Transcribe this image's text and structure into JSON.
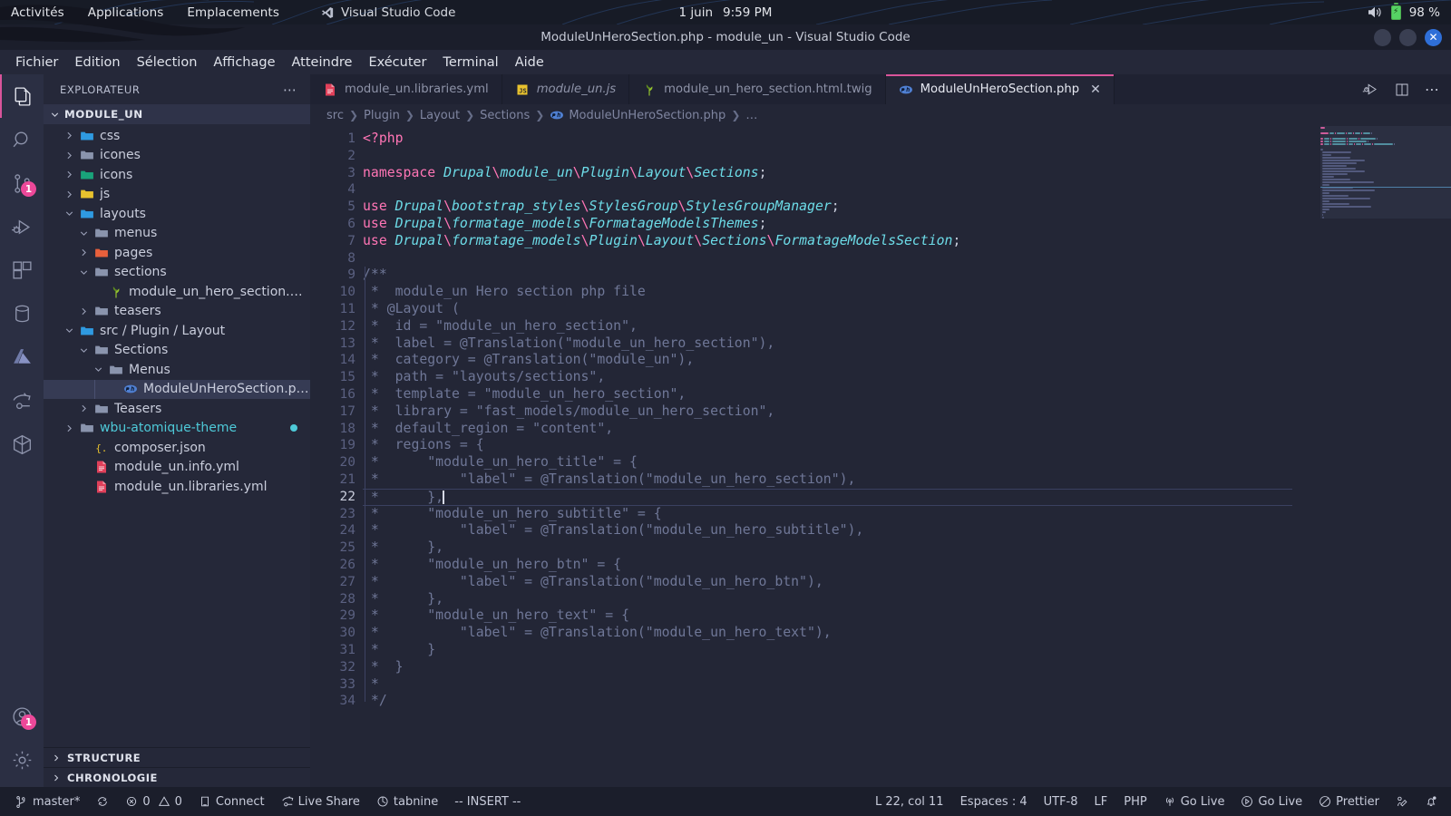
{
  "gnome": {
    "activities": "Activités",
    "applications": "Applications",
    "places": "Emplacements",
    "app_name": "Visual Studio Code",
    "app_icon": "vscode-icon",
    "date": "1 juin",
    "time": "9:59 PM",
    "volume_icon": "speaker-icon",
    "battery_icon": "battery-charging-icon",
    "battery": "98 %"
  },
  "window": {
    "title": "ModuleUnHeroSection.php - module_un - Visual Studio Code",
    "minimize_icon": "minimize-icon",
    "maximize_icon": "maximize-icon",
    "close_icon": "close-icon"
  },
  "menubar": {
    "items": [
      {
        "label": "Fichier"
      },
      {
        "label": "Edition"
      },
      {
        "label": "Sélection"
      },
      {
        "label": "Affichage"
      },
      {
        "label": "Atteindre"
      },
      {
        "label": "Exécuter"
      },
      {
        "label": "Terminal"
      },
      {
        "label": "Aide"
      }
    ]
  },
  "activitybar": {
    "items": [
      {
        "name": "explorer-icon",
        "badge": ""
      },
      {
        "name": "search-icon",
        "badge": ""
      },
      {
        "name": "source-control-icon",
        "badge": "1"
      },
      {
        "name": "run-debug-icon",
        "badge": ""
      },
      {
        "name": "extensions-icon",
        "badge": ""
      },
      {
        "name": "database-icon",
        "badge": ""
      },
      {
        "name": "azure-icon",
        "badge": ""
      },
      {
        "name": "live-share-icon",
        "badge": ""
      },
      {
        "name": "docker-icon",
        "badge": ""
      }
    ],
    "bottom": [
      {
        "name": "account-icon",
        "badge": "1"
      },
      {
        "name": "settings-gear-icon",
        "badge": ""
      }
    ]
  },
  "sidebar": {
    "title": "EXPLORATEUR",
    "more_icon": "more-actions-icon",
    "root": "MODULE_UN",
    "tree": [
      {
        "label": "css",
        "indent": 1,
        "type": "folder",
        "state": "collapsed",
        "color": "#2f9ae0"
      },
      {
        "label": "icones",
        "indent": 1,
        "type": "folder",
        "state": "collapsed",
        "color": "#8a94ad"
      },
      {
        "label": "icons",
        "indent": 1,
        "type": "folder",
        "state": "collapsed",
        "color": "#1aa37a"
      },
      {
        "label": "js",
        "indent": 1,
        "type": "folder",
        "state": "collapsed",
        "color": "#e8c22e"
      },
      {
        "label": "layouts",
        "indent": 1,
        "type": "folder",
        "state": "expanded",
        "color": "#2f9ae0"
      },
      {
        "label": "menus",
        "indent": 2,
        "type": "folder",
        "state": "expanded",
        "color": "#8a94ad"
      },
      {
        "label": "pages",
        "indent": 2,
        "type": "folder",
        "state": "collapsed",
        "color": "#e8603c"
      },
      {
        "label": "sections",
        "indent": 2,
        "type": "folder",
        "state": "expanded",
        "color": "#8a94ad"
      },
      {
        "label": "module_un_hero_section.html.twig",
        "indent": 3,
        "type": "twig",
        "state": "none",
        "color": "#93c22e"
      },
      {
        "label": "teasers",
        "indent": 2,
        "type": "folder",
        "state": "collapsed",
        "color": "#8a94ad"
      },
      {
        "label": "src / Plugin / Layout",
        "indent": 1,
        "type": "folder",
        "state": "expanded",
        "color": "#2f9ae0"
      },
      {
        "label": "Sections",
        "indent": 2,
        "type": "folder",
        "state": "expanded",
        "color": "#8a94ad"
      },
      {
        "label": "Menus",
        "indent": 3,
        "type": "folder",
        "state": "expanded",
        "color": "#8a94ad"
      },
      {
        "label": "ModuleUnHeroSection.php",
        "indent": 4,
        "type": "php",
        "state": "none",
        "color": "#4f7fd1",
        "selected": true
      },
      {
        "label": "Teasers",
        "indent": 2,
        "type": "folder",
        "state": "collapsed",
        "color": "#8a94ad"
      },
      {
        "label": "wbu-atomique-theme",
        "indent": 1,
        "type": "folder",
        "state": "collapsed",
        "color": "#8a94ad",
        "modified": true,
        "dot": true
      },
      {
        "label": "composer.json",
        "indent": 2,
        "type": "json",
        "state": "none",
        "color": "#e8c22e"
      },
      {
        "label": "module_un.info.yml",
        "indent": 2,
        "type": "yml",
        "state": "none",
        "color": "#e0405a"
      },
      {
        "label": "module_un.libraries.yml",
        "indent": 2,
        "type": "yml",
        "state": "none",
        "color": "#e0405a"
      }
    ],
    "panels": [
      {
        "label": "STRUCTURE"
      },
      {
        "label": "CHRONOLOGIE"
      }
    ]
  },
  "editor": {
    "tabs": [
      {
        "label": "module_un.libraries.yml",
        "icon": "yml-file-icon",
        "active": false,
        "italic": false,
        "iconColor": "#e0405a"
      },
      {
        "label": "module_un.js",
        "icon": "js-file-icon",
        "active": false,
        "italic": true,
        "iconColor": "#e8c22e"
      },
      {
        "label": "module_un_hero_section.html.twig",
        "icon": "twig-file-icon",
        "active": false,
        "italic": false,
        "iconColor": "#93c22e"
      },
      {
        "label": "ModuleUnHeroSection.php",
        "icon": "php-file-icon",
        "active": true,
        "italic": false,
        "iconColor": "#4f7fd1"
      }
    ],
    "tab_close_icon": "close-icon",
    "actions": [
      {
        "name": "run-and-debug-icon"
      },
      {
        "name": "split-editor-icon"
      },
      {
        "name": "more-actions-icon"
      }
    ],
    "breadcrumbs": [
      {
        "label": "src"
      },
      {
        "label": "Plugin"
      },
      {
        "label": "Layout"
      },
      {
        "label": "Sections"
      },
      {
        "label": "ModuleUnHeroSection.php",
        "icon": "php-file-icon"
      },
      {
        "label": "…"
      }
    ],
    "first_line": 1,
    "total_lines": 34,
    "cursor_line": 22,
    "lines": [
      {
        "n": 1,
        "tokens": [
          {
            "t": "<?php",
            "c": "tagphp"
          }
        ]
      },
      {
        "n": 2,
        "tokens": []
      },
      {
        "n": 3,
        "tokens": [
          {
            "t": "namespace ",
            "c": "kw"
          },
          {
            "t": "Drupal",
            "c": "cls"
          },
          {
            "t": "\\",
            "c": "sep"
          },
          {
            "t": "module_un",
            "c": "cls"
          },
          {
            "t": "\\",
            "c": "sep"
          },
          {
            "t": "Plugin",
            "c": "cls"
          },
          {
            "t": "\\",
            "c": "sep"
          },
          {
            "t": "Layout",
            "c": "cls"
          },
          {
            "t": "\\",
            "c": "sep"
          },
          {
            "t": "Sections",
            "c": "cls"
          },
          {
            "t": ";",
            "c": "punc"
          }
        ]
      },
      {
        "n": 4,
        "tokens": []
      },
      {
        "n": 5,
        "tokens": [
          {
            "t": "use ",
            "c": "kw"
          },
          {
            "t": "Drupal",
            "c": "cls"
          },
          {
            "t": "\\",
            "c": "sep"
          },
          {
            "t": "bootstrap_styles",
            "c": "cls"
          },
          {
            "t": "\\",
            "c": "sep"
          },
          {
            "t": "StylesGroup",
            "c": "cls"
          },
          {
            "t": "\\",
            "c": "sep"
          },
          {
            "t": "StylesGroupManager",
            "c": "cls"
          },
          {
            "t": ";",
            "c": "punc"
          }
        ]
      },
      {
        "n": 6,
        "tokens": [
          {
            "t": "use ",
            "c": "kw"
          },
          {
            "t": "Drupal",
            "c": "cls"
          },
          {
            "t": "\\",
            "c": "sep"
          },
          {
            "t": "formatage_models",
            "c": "cls"
          },
          {
            "t": "\\",
            "c": "sep"
          },
          {
            "t": "FormatageModelsThemes",
            "c": "cls"
          },
          {
            "t": ";",
            "c": "punc"
          }
        ]
      },
      {
        "n": 7,
        "tokens": [
          {
            "t": "use ",
            "c": "kw"
          },
          {
            "t": "Drupal",
            "c": "cls"
          },
          {
            "t": "\\",
            "c": "sep"
          },
          {
            "t": "formatage_models",
            "c": "cls"
          },
          {
            "t": "\\",
            "c": "sep"
          },
          {
            "t": "Plugin",
            "c": "cls"
          },
          {
            "t": "\\",
            "c": "sep"
          },
          {
            "t": "Layout",
            "c": "cls"
          },
          {
            "t": "\\",
            "c": "sep"
          },
          {
            "t": "Sections",
            "c": "cls"
          },
          {
            "t": "\\",
            "c": "sep"
          },
          {
            "t": "FormatageModelsSection",
            "c": "cls"
          },
          {
            "t": ";",
            "c": "punc"
          }
        ]
      },
      {
        "n": 8,
        "tokens": []
      },
      {
        "n": 9,
        "tokens": [
          {
            "t": "/**",
            "c": "cm"
          }
        ]
      },
      {
        "n": 10,
        "tokens": [
          {
            "t": " *  module_un Hero section php file",
            "c": "cm"
          }
        ]
      },
      {
        "n": 11,
        "tokens": [
          {
            "t": " * @Layout (",
            "c": "cm"
          }
        ]
      },
      {
        "n": 12,
        "tokens": [
          {
            "t": " *  id = \"module_un_hero_section\",",
            "c": "cm"
          }
        ]
      },
      {
        "n": 13,
        "tokens": [
          {
            "t": " *  label = @Translation(\"module_un_hero_section\"),",
            "c": "cm"
          }
        ]
      },
      {
        "n": 14,
        "tokens": [
          {
            "t": " *  category = @Translation(\"module_un\"),",
            "c": "cm"
          }
        ]
      },
      {
        "n": 15,
        "tokens": [
          {
            "t": " *  path = \"layouts/sections\",",
            "c": "cm"
          }
        ]
      },
      {
        "n": 16,
        "tokens": [
          {
            "t": " *  template = \"module_un_hero_section\",",
            "c": "cm"
          }
        ]
      },
      {
        "n": 17,
        "tokens": [
          {
            "t": " *  library = \"fast_models/module_un_hero_section\",",
            "c": "cm"
          }
        ]
      },
      {
        "n": 18,
        "tokens": [
          {
            "t": " *  default_region = \"content\",",
            "c": "cm"
          }
        ]
      },
      {
        "n": 19,
        "tokens": [
          {
            "t": " *  regions = {",
            "c": "cm"
          }
        ]
      },
      {
        "n": 20,
        "tokens": [
          {
            "t": " *      \"module_un_hero_title\" = {",
            "c": "cm"
          }
        ]
      },
      {
        "n": 21,
        "tokens": [
          {
            "t": " *          \"label\" = @Translation(\"module_un_hero_section\"),",
            "c": "cm"
          }
        ]
      },
      {
        "n": 22,
        "tokens": [
          {
            "t": " *      },",
            "c": "cm"
          }
        ],
        "cursor": true
      },
      {
        "n": 23,
        "tokens": [
          {
            "t": " *      \"module_un_hero_subtitle\" = {",
            "c": "cm"
          }
        ]
      },
      {
        "n": 24,
        "tokens": [
          {
            "t": " *          \"label\" = @Translation(\"module_un_hero_subtitle\"),",
            "c": "cm"
          }
        ]
      },
      {
        "n": 25,
        "tokens": [
          {
            "t": " *      },",
            "c": "cm"
          }
        ]
      },
      {
        "n": 26,
        "tokens": [
          {
            "t": " *      \"module_un_hero_btn\" = {",
            "c": "cm"
          }
        ]
      },
      {
        "n": 27,
        "tokens": [
          {
            "t": " *          \"label\" = @Translation(\"module_un_hero_btn\"),",
            "c": "cm"
          }
        ]
      },
      {
        "n": 28,
        "tokens": [
          {
            "t": " *      },",
            "c": "cm"
          }
        ]
      },
      {
        "n": 29,
        "tokens": [
          {
            "t": " *      \"module_un_hero_text\" = {",
            "c": "cm"
          }
        ]
      },
      {
        "n": 30,
        "tokens": [
          {
            "t": " *          \"label\" = @Translation(\"module_un_hero_text\"),",
            "c": "cm"
          }
        ]
      },
      {
        "n": 31,
        "tokens": [
          {
            "t": " *      }",
            "c": "cm"
          }
        ]
      },
      {
        "n": 32,
        "tokens": [
          {
            "t": " *  }",
            "c": "cm"
          }
        ]
      },
      {
        "n": 33,
        "tokens": [
          {
            "t": " *",
            "c": "cm"
          }
        ]
      },
      {
        "n": 34,
        "tokens": [
          {
            "t": " */",
            "c": "cm"
          }
        ]
      }
    ]
  },
  "statusbar": {
    "left": [
      {
        "label": "master*",
        "icon": "source-control-branch-icon",
        "name": "status-branch"
      },
      {
        "label": "",
        "icon": "sync-icon",
        "name": "status-sync"
      },
      {
        "label": "0  0",
        "icon": "errors-warnings-icon",
        "name": "status-problems",
        "errors": "0",
        "warnings": "0"
      },
      {
        "label": "Connect",
        "icon": "remote-connect-icon",
        "name": "status-connect"
      },
      {
        "label": "Live Share",
        "icon": "live-share-icon",
        "name": "status-live-share"
      },
      {
        "label": "tabnine",
        "icon": "tabnine-icon",
        "name": "status-tabnine"
      },
      {
        "label": "-- INSERT --",
        "icon": "",
        "name": "status-vim-mode"
      }
    ],
    "right": [
      {
        "label": "L 22, col 11",
        "icon": "",
        "name": "status-cursor-position"
      },
      {
        "label": "Espaces : 4",
        "icon": "",
        "name": "status-indentation"
      },
      {
        "label": "UTF-8",
        "icon": "",
        "name": "status-encoding"
      },
      {
        "label": "LF",
        "icon": "",
        "name": "status-eol"
      },
      {
        "label": "PHP",
        "icon": "",
        "name": "status-language-mode"
      },
      {
        "label": "Go Live",
        "icon": "broadcast-icon",
        "name": "status-go-live-1"
      },
      {
        "label": "Go Live",
        "icon": "play-circle-icon",
        "name": "status-go-live-2"
      },
      {
        "label": "Prettier",
        "icon": "prettier-icon",
        "name": "status-prettier"
      },
      {
        "label": "",
        "icon": "feedback-icon",
        "name": "status-feedback"
      },
      {
        "label": "",
        "icon": "bell-dot-icon",
        "name": "status-notifications"
      }
    ]
  },
  "colors": {
    "accent_pink": "#d9549a",
    "badge_pink": "#ec4899",
    "editor_bg": "#232636",
    "sidebar_bg": "#252839",
    "activitybar_bg": "#2b2f43",
    "keyword": "#ff75b5",
    "class": "#6ddce8",
    "comment": "#6f7797",
    "modified_file": "#4ec9d8"
  }
}
